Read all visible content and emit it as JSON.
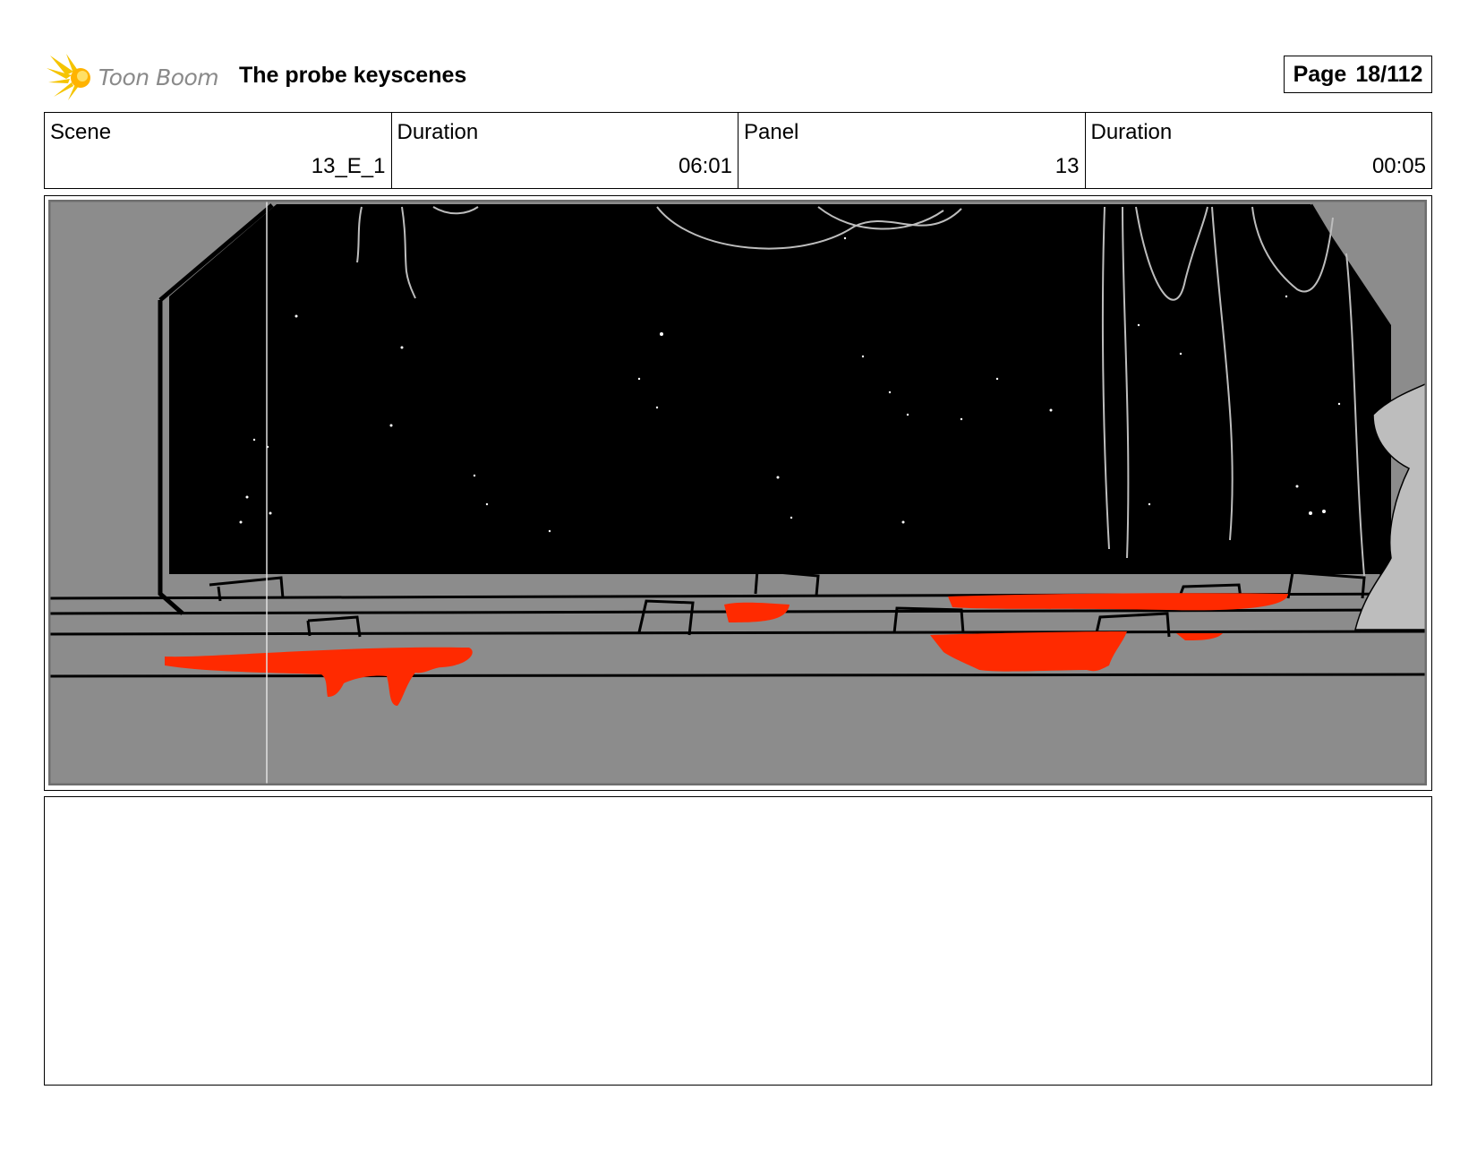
{
  "header": {
    "logo_text": "Toon Boom",
    "title": "The probe keyscenes",
    "page_label": "Page",
    "page_number": "18/112"
  },
  "info": {
    "scene_label": "Scene",
    "scene_value": "13_E_1",
    "scene_duration_label": "Duration",
    "scene_duration_value": "06:01",
    "panel_label": "Panel",
    "panel_value": "13",
    "panel_duration_label": "Duration",
    "panel_duration_value": "00:05"
  },
  "panel_image": {
    "icon": "storyboard-sketch",
    "colors": {
      "sky": "#000000",
      "floor": "#8c8c8c",
      "blood": "#ff2a00",
      "sketch": "#bdbdbd"
    }
  },
  "notes": {
    "text": ""
  }
}
